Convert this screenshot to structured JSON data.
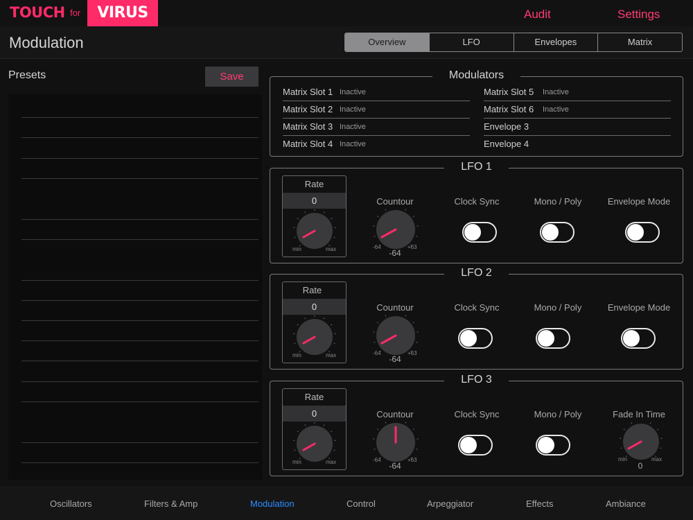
{
  "app": {
    "logo_touch": "TOUCH",
    "logo_for": "for",
    "logo_virus": "VIRUS",
    "audit_label": "Audit",
    "settings_label": "Settings",
    "accent_color": "#ff2a68"
  },
  "header": {
    "title": "Modulation",
    "tabs": [
      {
        "label": "Overview",
        "active": true
      },
      {
        "label": "LFO",
        "active": false
      },
      {
        "label": "Envelopes",
        "active": false
      },
      {
        "label": "Matrix",
        "active": false
      }
    ]
  },
  "presets": {
    "title": "Presets",
    "save_label": "Save"
  },
  "modulators": {
    "title": "Modulators",
    "left": [
      {
        "name": "Matrix Slot 1",
        "state": "Inactive"
      },
      {
        "name": "Matrix Slot 2",
        "state": "Inactive"
      },
      {
        "name": "Matrix Slot 3",
        "state": "Inactive"
      },
      {
        "name": "Matrix Slot 4",
        "state": "Inactive"
      }
    ],
    "right": [
      {
        "name": "Matrix Slot 5",
        "state": "Inactive"
      },
      {
        "name": "Matrix Slot 6",
        "state": "Inactive"
      },
      {
        "name": "Envelope 3",
        "state": ""
      },
      {
        "name": "Envelope 4",
        "state": ""
      }
    ]
  },
  "lfos": [
    {
      "title": "LFO 1",
      "rate_label": "Rate",
      "rate_value": "0",
      "rate_min": "min",
      "rate_max": "max",
      "contour_label": "Countour",
      "contour_value": "-64",
      "contour_min": "-64",
      "contour_max": "+63",
      "clock_sync_label": "Clock Sync",
      "clock_sync_on": false,
      "mono_poly_label": "Mono / Poly",
      "mono_poly_on": false,
      "last_label": "Envelope Mode",
      "last_on": false
    },
    {
      "title": "LFO 2",
      "rate_label": "Rate",
      "rate_value": "0",
      "rate_min": "min",
      "rate_max": "max",
      "contour_label": "Countour",
      "contour_value": "-64",
      "contour_min": "-64",
      "contour_max": "+63",
      "clock_sync_label": "Clock Sync",
      "clock_sync_on": false,
      "mono_poly_label": "Mono / Poly",
      "mono_poly_on": false,
      "last_label": "Envelope Mode",
      "last_on": false
    },
    {
      "title": "LFO 3",
      "rate_label": "Rate",
      "rate_value": "0",
      "rate_min": "min",
      "rate_max": "max",
      "contour_label": "Countour",
      "contour_value": "-64",
      "contour_min": "-64",
      "contour_max": "+63",
      "clock_sync_label": "Clock Sync",
      "clock_sync_on": false,
      "mono_poly_label": "Mono / Poly",
      "mono_poly_on": false,
      "last_label": "Fade In Time",
      "last_value": "0",
      "last_min": "min",
      "last_max": "max"
    }
  ],
  "bottom_nav": [
    {
      "label": "Oscillators",
      "active": false
    },
    {
      "label": "Filters & Amp",
      "active": false
    },
    {
      "label": "Modulation",
      "active": true
    },
    {
      "label": "Control",
      "active": false
    },
    {
      "label": "Arpeggiator",
      "active": false
    },
    {
      "label": "Effects",
      "active": false
    },
    {
      "label": "Ambiance",
      "active": false
    }
  ]
}
